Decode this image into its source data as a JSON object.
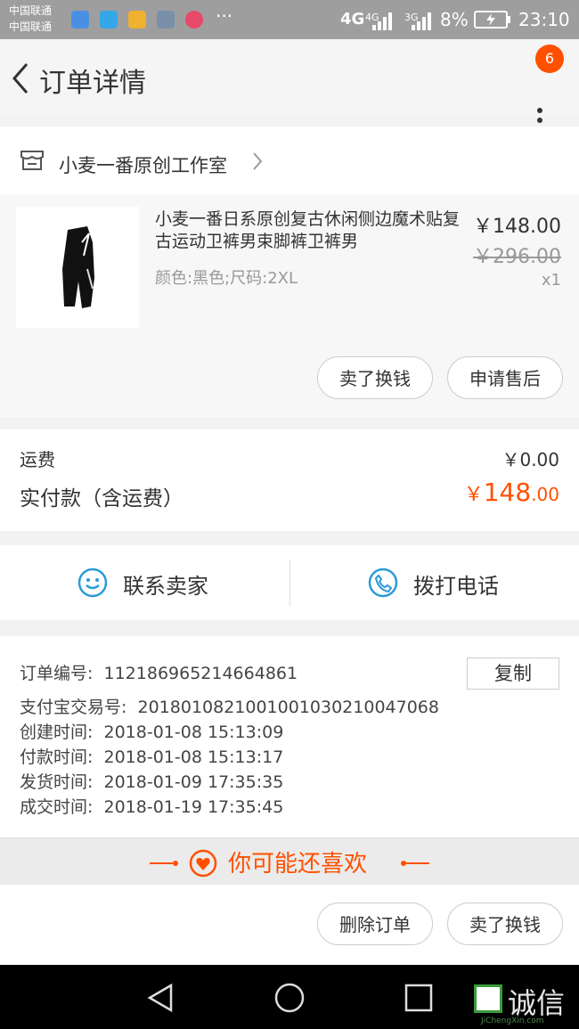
{
  "status_bar": {
    "carrier1": "中国联通",
    "carrier2": "中国联通",
    "network1": "4G",
    "network2": "4G",
    "network3": "3G",
    "battery": "8%",
    "time": "23:10"
  },
  "header": {
    "title": "订单详情",
    "badge_count": "6"
  },
  "store": {
    "name": "小麦一番原创工作室"
  },
  "product": {
    "title": "小麦一番日系原创复古休闲侧边魔术贴复古运动卫裤男束脚裤卫裤男",
    "spec": "颜色:黑色;尺码:2XL",
    "price": "￥148.00",
    "original_price": "￥296.00",
    "quantity": "x1",
    "actions": [
      "卖了换钱",
      "申请售后"
    ]
  },
  "payment": {
    "shipping_label": "运费",
    "shipping_value": "￥0.00",
    "paid_label": "实付款（含运费）",
    "paid_currency": "￥",
    "paid_int": "148",
    "paid_dec": ".00"
  },
  "contact": {
    "seller_label": "联系卖家",
    "phone_label": "拨打电话"
  },
  "order_info": {
    "order_no_label": "订单编号:",
    "order_no": "112186965214664861",
    "copy_label": "复制",
    "alipay_label": "支付宝交易号:",
    "alipay_no": "2018010821001001030210047068",
    "created_label": "创建时间:",
    "created": "2018-01-08 15:13:09",
    "paid_label": "付款时间:",
    "paid": "2018-01-08 15:13:17",
    "shipped_label": "发货时间:",
    "shipped": "2018-01-09 17:35:35",
    "done_label": "成交时间:",
    "done": "2018-01-19 17:35:45"
  },
  "recommend": {
    "label": "你可能还喜欢"
  },
  "bottom_actions": [
    "删除订单",
    "卖了换钱"
  ],
  "watermark": {
    "text": "诚信",
    "sub": "JiChengXin.com"
  },
  "colors": {
    "accent": "#ff5000",
    "blue": "#2b9bd6"
  },
  "icons": [
    "back-icon",
    "more-icon",
    "store-icon",
    "chevron-right-icon",
    "smile-chat-icon",
    "phone-icon",
    "heart-icon",
    "nav-back-icon",
    "nav-home-icon",
    "nav-recent-icon"
  ]
}
